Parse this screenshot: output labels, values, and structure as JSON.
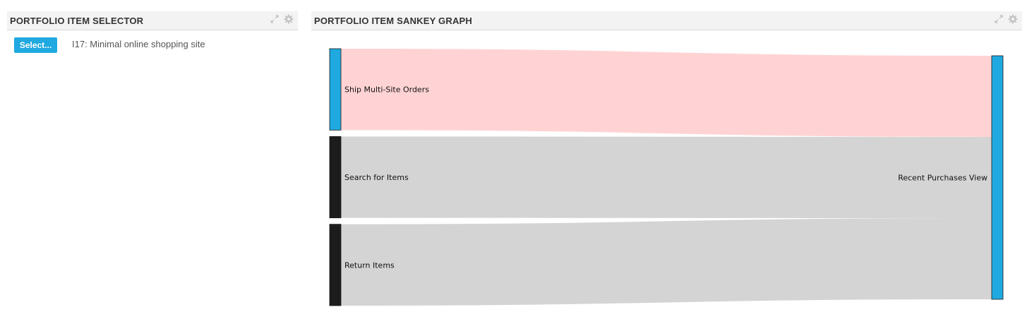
{
  "selector_panel": {
    "title": "PORTFOLIO ITEM SELECTOR",
    "select_button_label": "Select...",
    "selected_item": "I17: Minimal online shopping site"
  },
  "sankey_panel": {
    "title": "PORTFOLIO ITEM SANKEY GRAPH"
  },
  "icons": {
    "expand": "expand-icon",
    "settings": "gear-icon"
  },
  "colors": {
    "accent": "#1fa9e0",
    "highlight_link": "#ffd3d4",
    "default_link": "#d4d4d4",
    "dark_node": "#1c1c1c",
    "header_bg": "#f3f3f3"
  },
  "chart_data": {
    "type": "sankey",
    "nodes": [
      {
        "id": "ship",
        "label": "Ship Multi-Site Orders",
        "side": "source",
        "color": "#1fa9e0"
      },
      {
        "id": "search",
        "label": "Search for Items",
        "side": "source",
        "color": "#1c1c1c"
      },
      {
        "id": "return",
        "label": "Return Items",
        "side": "source",
        "color": "#1c1c1c"
      },
      {
        "id": "recent",
        "label": "Recent Purchases View",
        "side": "target",
        "color": "#1fa9e0"
      }
    ],
    "links": [
      {
        "source": "ship",
        "target": "recent",
        "value": 1,
        "color": "#ffd3d4"
      },
      {
        "source": "search",
        "target": "recent",
        "value": 1,
        "color": "#d4d4d4"
      },
      {
        "source": "return",
        "target": "recent",
        "value": 1,
        "color": "#d4d4d4"
      }
    ]
  }
}
